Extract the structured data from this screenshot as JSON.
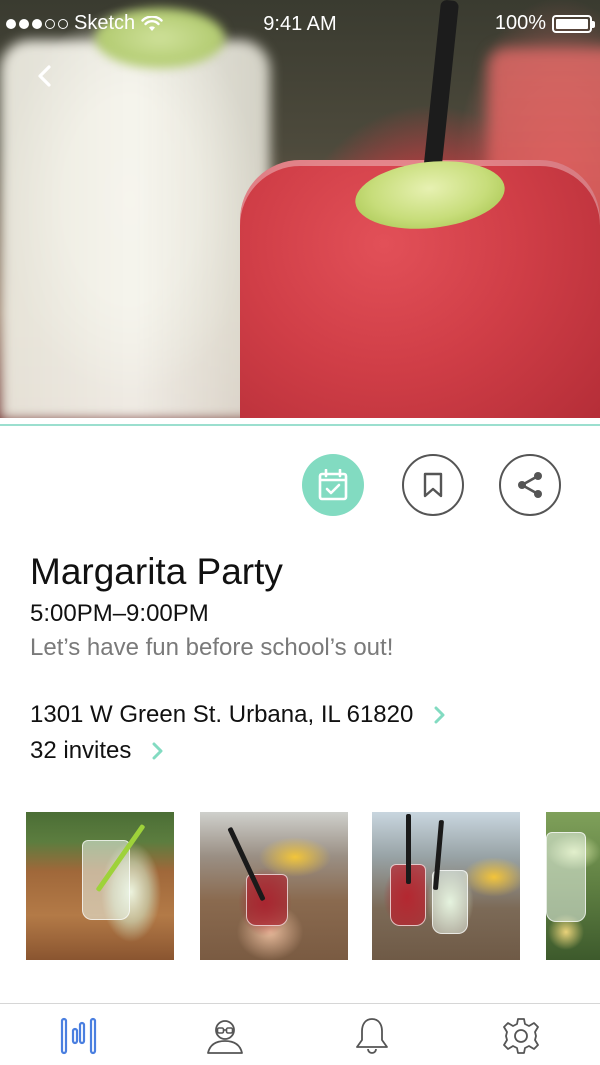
{
  "status_bar": {
    "carrier": "Sketch",
    "time": "9:41 AM",
    "battery": "100%"
  },
  "event": {
    "title": "Margarita Party",
    "time": "5:00PM–9:00PM",
    "description": "Let’s have fun before school’s out!",
    "address": "1301 W Green St. Urbana, IL 61820",
    "invites": "32 invites"
  },
  "actions": [
    {
      "icon": "calendar-check-icon",
      "active": true
    },
    {
      "icon": "bookmark-icon",
      "active": false
    },
    {
      "icon": "share-icon",
      "active": false
    }
  ],
  "tab_bar": {
    "tabs": [
      {
        "icon": "feed-icon",
        "active": true
      },
      {
        "icon": "profile-icon",
        "active": false
      },
      {
        "icon": "bell-icon",
        "active": false
      },
      {
        "icon": "gear-icon",
        "active": false
      }
    ]
  },
  "colors": {
    "accent": "#82dbc1",
    "accent_line": "#9bdfcf",
    "tab_active": "#4a7fe0",
    "icon_inactive": "#555555",
    "secondary_text": "#7a7a7a"
  }
}
